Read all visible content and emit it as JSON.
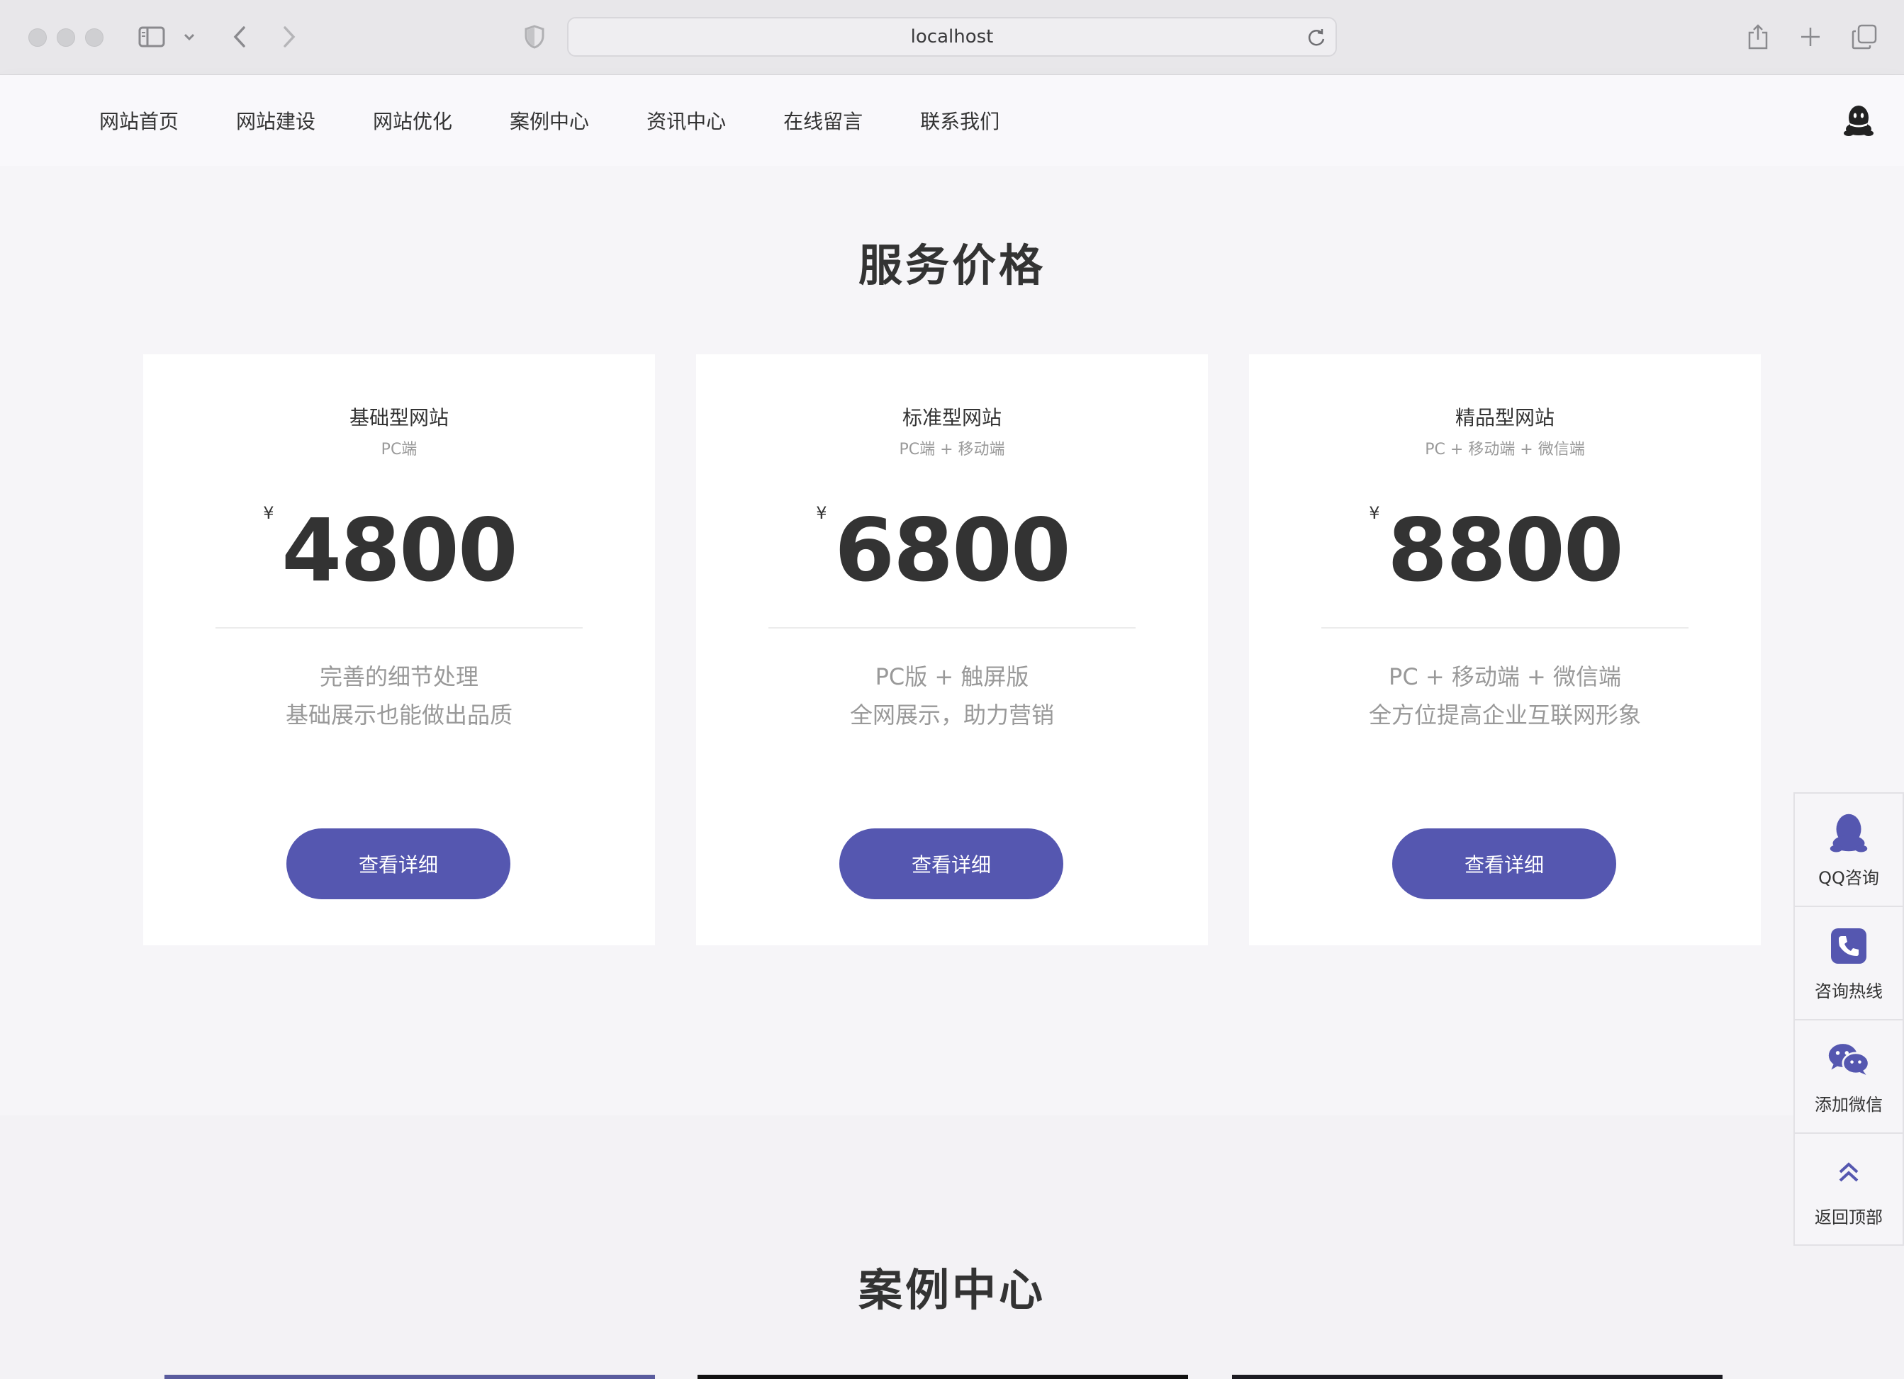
{
  "browser": {
    "url": "localhost"
  },
  "nav": {
    "items": [
      "网站首页",
      "网站建设",
      "网站优化",
      "案例中心",
      "资讯中心",
      "在线留言",
      "联系我们"
    ]
  },
  "pricing": {
    "title": "服务价格",
    "currency_symbol": "¥",
    "plans": [
      {
        "name": "基础型网站",
        "platform": "PC端",
        "price": "4800",
        "feature_1": "完善的细节处理",
        "feature_2": "基础展示也能做出品质",
        "button": "查看详细"
      },
      {
        "name": "标准型网站",
        "platform": "PC端 + 移动端",
        "price": "6800",
        "feature_1": "PC版 + 触屏版",
        "feature_2": "全网展示，助力营销",
        "button": "查看详细"
      },
      {
        "name": "精品型网站",
        "platform": "PC + 移动端 + 微信端",
        "price": "8800",
        "feature_1": "PC + 移动端 + 微信端",
        "feature_2": "全方位提高企业互联网形象",
        "button": "查看详细"
      }
    ]
  },
  "cases": {
    "title": "案例中心"
  },
  "float_bar": {
    "items": [
      {
        "label": "QQ咨询",
        "icon": "qq-icon"
      },
      {
        "label": "咨询热线",
        "icon": "phone-icon"
      },
      {
        "label": "添加微信",
        "icon": "wechat-icon"
      },
      {
        "label": "返回顶部",
        "icon": "double-chevron-up-icon"
      }
    ]
  },
  "colors": {
    "accent": "#5557b0",
    "page_bg": "#f6f5f8",
    "card_bg": "#ffffff"
  }
}
